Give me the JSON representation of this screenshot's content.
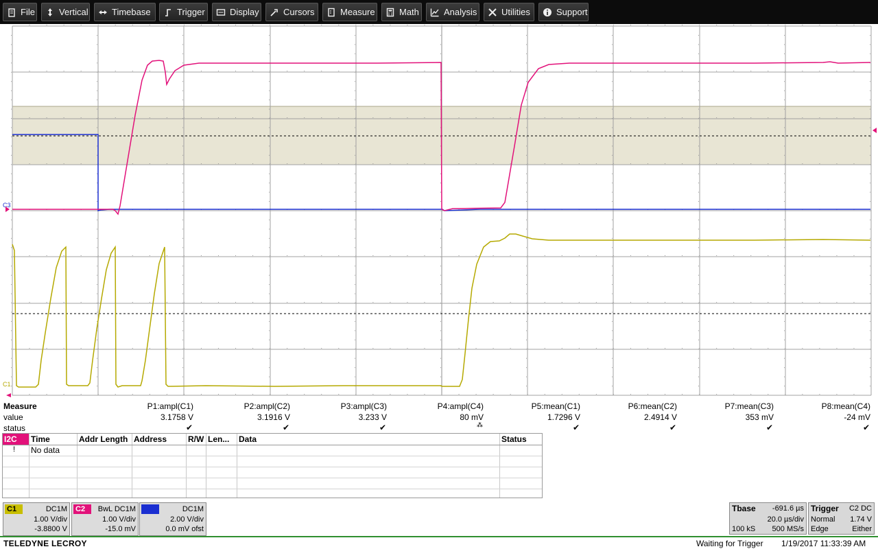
{
  "menu": [
    {
      "label": "File",
      "icon": "file-icon"
    },
    {
      "label": "Vertical",
      "icon": "vertical-arrows-icon"
    },
    {
      "label": "Timebase",
      "icon": "horizontal-arrows-icon"
    },
    {
      "label": "Trigger",
      "icon": "trigger-icon"
    },
    {
      "label": "Display",
      "icon": "display-icon"
    },
    {
      "label": "Cursors",
      "icon": "cursor-icon"
    },
    {
      "label": "Measure",
      "icon": "measure-icon"
    },
    {
      "label": "Math",
      "icon": "calculator-icon"
    },
    {
      "label": "Analysis",
      "icon": "analysis-chart-icon"
    },
    {
      "label": "Utilities",
      "icon": "wrench-icon"
    },
    {
      "label": "Support",
      "icon": "info-icon"
    }
  ],
  "colors": {
    "c1": "#b5a900",
    "c2": "#e2117a",
    "c3": "#1a2fd1",
    "background": "#ffffff",
    "grid": "#a0a0a0",
    "zone": "#e8e5d4",
    "menubar": "#0c0c0c"
  },
  "grid_markers": {
    "c3": "C3",
    "c1": "C1"
  },
  "measure": {
    "title": "Measure",
    "row_labels": [
      "value",
      "status"
    ],
    "params": [
      {
        "name": "P1:ampl(C1)",
        "value": "3.1758 V",
        "status": "check"
      },
      {
        "name": "P2:ampl(C2)",
        "value": "3.1916 V",
        "status": "check"
      },
      {
        "name": "P3:ampl(C3)",
        "value": "3.233 V",
        "status": "check"
      },
      {
        "name": "P4:ampl(C4)",
        "value": "80 mV",
        "status": "warning"
      },
      {
        "name": "P5:mean(C1)",
        "value": "1.7296 V",
        "status": "check"
      },
      {
        "name": "P6:mean(C2)",
        "value": "2.4914 V",
        "status": "check"
      },
      {
        "name": "P7:mean(C3)",
        "value": "353 mV",
        "status": "check"
      },
      {
        "name": "P8:mean(C4)",
        "value": "-24 mV",
        "status": "check"
      }
    ]
  },
  "i2c_table": {
    "tab": "I2C",
    "columns": [
      "Time",
      "Addr Length",
      "Address",
      "R/W",
      "Len...",
      "Data",
      "Status"
    ],
    "rows": [
      {
        "marker": "!",
        "time": "No data"
      }
    ]
  },
  "channels": [
    {
      "tag": "C1",
      "coupling": "DC1M",
      "scale": "1.00 V/div",
      "offset": "-3.8800 V",
      "color": "#c8be00"
    },
    {
      "tag": "C2",
      "coupling": "BwL DC1M",
      "scale": "1.00 V/div",
      "offset": "-15.0 mV",
      "color": "#e2117a"
    },
    {
      "tag": "C3",
      "coupling": "DC1M",
      "scale": "2.00 V/div",
      "offset": "0.0 mV ofst",
      "color": "#1a2fd1"
    }
  ],
  "timebase": {
    "label": "Tbase",
    "delay": "-691.6 µs",
    "scale": "20.0 µs/div",
    "samples": "100 kS",
    "rate": "500 MS/s"
  },
  "trigger": {
    "label": "Trigger",
    "source": "C2 DC",
    "mode": "Normal",
    "level": "1.74 V",
    "type": "Edge",
    "slope": "Either"
  },
  "status": {
    "brand": "TELEDYNE LECROY",
    "message": "Waiting for Trigger",
    "datetime": "1/19/2017 11:33:39 AM"
  }
}
